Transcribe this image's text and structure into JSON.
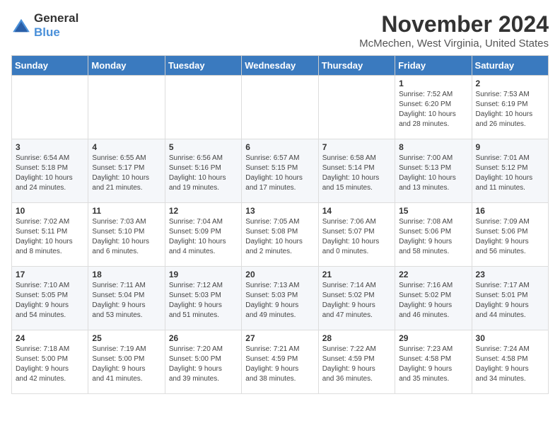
{
  "header": {
    "logo": {
      "general": "General",
      "blue": "Blue"
    },
    "title": "November 2024",
    "location": "McMechen, West Virginia, United States"
  },
  "weekdays": [
    "Sunday",
    "Monday",
    "Tuesday",
    "Wednesday",
    "Thursday",
    "Friday",
    "Saturday"
  ],
  "weeks": [
    [
      {
        "day": "",
        "info": ""
      },
      {
        "day": "",
        "info": ""
      },
      {
        "day": "",
        "info": ""
      },
      {
        "day": "",
        "info": ""
      },
      {
        "day": "",
        "info": ""
      },
      {
        "day": "1",
        "info": "Sunrise: 7:52 AM\nSunset: 6:20 PM\nDaylight: 10 hours\nand 28 minutes."
      },
      {
        "day": "2",
        "info": "Sunrise: 7:53 AM\nSunset: 6:19 PM\nDaylight: 10 hours\nand 26 minutes."
      }
    ],
    [
      {
        "day": "3",
        "info": "Sunrise: 6:54 AM\nSunset: 5:18 PM\nDaylight: 10 hours\nand 24 minutes."
      },
      {
        "day": "4",
        "info": "Sunrise: 6:55 AM\nSunset: 5:17 PM\nDaylight: 10 hours\nand 21 minutes."
      },
      {
        "day": "5",
        "info": "Sunrise: 6:56 AM\nSunset: 5:16 PM\nDaylight: 10 hours\nand 19 minutes."
      },
      {
        "day": "6",
        "info": "Sunrise: 6:57 AM\nSunset: 5:15 PM\nDaylight: 10 hours\nand 17 minutes."
      },
      {
        "day": "7",
        "info": "Sunrise: 6:58 AM\nSunset: 5:14 PM\nDaylight: 10 hours\nand 15 minutes."
      },
      {
        "day": "8",
        "info": "Sunrise: 7:00 AM\nSunset: 5:13 PM\nDaylight: 10 hours\nand 13 minutes."
      },
      {
        "day": "9",
        "info": "Sunrise: 7:01 AM\nSunset: 5:12 PM\nDaylight: 10 hours\nand 11 minutes."
      }
    ],
    [
      {
        "day": "10",
        "info": "Sunrise: 7:02 AM\nSunset: 5:11 PM\nDaylight: 10 hours\nand 8 minutes."
      },
      {
        "day": "11",
        "info": "Sunrise: 7:03 AM\nSunset: 5:10 PM\nDaylight: 10 hours\nand 6 minutes."
      },
      {
        "day": "12",
        "info": "Sunrise: 7:04 AM\nSunset: 5:09 PM\nDaylight: 10 hours\nand 4 minutes."
      },
      {
        "day": "13",
        "info": "Sunrise: 7:05 AM\nSunset: 5:08 PM\nDaylight: 10 hours\nand 2 minutes."
      },
      {
        "day": "14",
        "info": "Sunrise: 7:06 AM\nSunset: 5:07 PM\nDaylight: 10 hours\nand 0 minutes."
      },
      {
        "day": "15",
        "info": "Sunrise: 7:08 AM\nSunset: 5:06 PM\nDaylight: 9 hours\nand 58 minutes."
      },
      {
        "day": "16",
        "info": "Sunrise: 7:09 AM\nSunset: 5:06 PM\nDaylight: 9 hours\nand 56 minutes."
      }
    ],
    [
      {
        "day": "17",
        "info": "Sunrise: 7:10 AM\nSunset: 5:05 PM\nDaylight: 9 hours\nand 54 minutes."
      },
      {
        "day": "18",
        "info": "Sunrise: 7:11 AM\nSunset: 5:04 PM\nDaylight: 9 hours\nand 53 minutes."
      },
      {
        "day": "19",
        "info": "Sunrise: 7:12 AM\nSunset: 5:03 PM\nDaylight: 9 hours\nand 51 minutes."
      },
      {
        "day": "20",
        "info": "Sunrise: 7:13 AM\nSunset: 5:03 PM\nDaylight: 9 hours\nand 49 minutes."
      },
      {
        "day": "21",
        "info": "Sunrise: 7:14 AM\nSunset: 5:02 PM\nDaylight: 9 hours\nand 47 minutes."
      },
      {
        "day": "22",
        "info": "Sunrise: 7:16 AM\nSunset: 5:02 PM\nDaylight: 9 hours\nand 46 minutes."
      },
      {
        "day": "23",
        "info": "Sunrise: 7:17 AM\nSunset: 5:01 PM\nDaylight: 9 hours\nand 44 minutes."
      }
    ],
    [
      {
        "day": "24",
        "info": "Sunrise: 7:18 AM\nSunset: 5:00 PM\nDaylight: 9 hours\nand 42 minutes."
      },
      {
        "day": "25",
        "info": "Sunrise: 7:19 AM\nSunset: 5:00 PM\nDaylight: 9 hours\nand 41 minutes."
      },
      {
        "day": "26",
        "info": "Sunrise: 7:20 AM\nSunset: 5:00 PM\nDaylight: 9 hours\nand 39 minutes."
      },
      {
        "day": "27",
        "info": "Sunrise: 7:21 AM\nSunset: 4:59 PM\nDaylight: 9 hours\nand 38 minutes."
      },
      {
        "day": "28",
        "info": "Sunrise: 7:22 AM\nSunset: 4:59 PM\nDaylight: 9 hours\nand 36 minutes."
      },
      {
        "day": "29",
        "info": "Sunrise: 7:23 AM\nSunset: 4:58 PM\nDaylight: 9 hours\nand 35 minutes."
      },
      {
        "day": "30",
        "info": "Sunrise: 7:24 AM\nSunset: 4:58 PM\nDaylight: 9 hours\nand 34 minutes."
      }
    ]
  ]
}
